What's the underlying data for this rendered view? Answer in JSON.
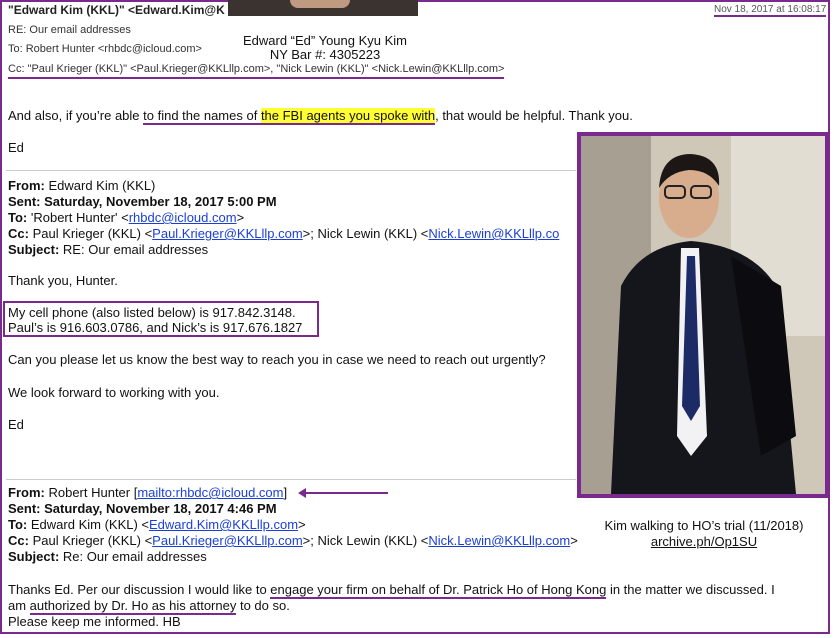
{
  "header": {
    "from": "\"Edward Kim (KKL)\" <Edward.Kim@K",
    "date": "Nov 18, 2017 at 16:08:17",
    "subject": "RE: Our email addresses",
    "to": "To: Robert Hunter <rhbdc@icloud.com>",
    "cc": "Cc: \"Paul Krieger (KKL)\" <Paul.Krieger@KKLllp.com>, \"Nick Lewin (KKL)\" <Nick.Lewin@KKLllp.com>"
  },
  "attorney": {
    "name": "Edward “Ed” Young Kyu Kim",
    "bar": "NY Bar #: 4305223"
  },
  "reply": {
    "line1_pre": "And also, if you’re able ",
    "line1_ul_a": "to find the names of ",
    "line1_hl": "the FBI agents you spoke with",
    "line1_post": ", that would be helpful.  Thank you.",
    "sign": "Ed"
  },
  "msg1": {
    "from_label": "From:",
    "from": "Edward Kim (KKL)",
    "sent_label": "Sent:",
    "sent": "Saturday, November 18, 2017 5:00 PM",
    "to_label": "To:",
    "to_pre": "'Robert Hunter' <",
    "to_link": "rhbdc@icloud.com",
    "to_post": ">",
    "cc_label": "Cc:",
    "cc_pre": "Paul Krieger (KKL) <",
    "cc_link1": "Paul.Krieger@KKLllp.com",
    "cc_mid": ">; Nick Lewin (KKL) <",
    "cc_link2": "Nick.Lewin@KKLllp.co",
    "subject_label": "Subject:",
    "subject": "RE: Our email addresses",
    "greeting": "Thank you, Hunter.",
    "phone1": "My cell phone (also listed below) is 917.842.3148.",
    "phone2": "Paul’s is 916.603.0786, and Nick’s is 917.676.1827",
    "ask": "Can you please let us know the best way to reach you in case we need to reach out urgently?",
    "look": "We look forward to working with you.",
    "sign": "Ed"
  },
  "msg2": {
    "from_label": "From:",
    "from_pre": "Robert Hunter [",
    "from_link": "mailto:rhbdc@icloud.com",
    "from_post": "]",
    "sent_label": "Sent:",
    "sent": "Saturday, November 18, 2017 4:46 PM",
    "to_label": "To:",
    "to_pre": "Edward Kim (KKL) <",
    "to_link": "Edward.Kim@KKLllp.com",
    "to_post": ">",
    "cc_label": "Cc:",
    "cc_pre": "Paul Krieger (KKL) <",
    "cc_link1": "Paul.Krieger@KKLllp.com",
    "cc_mid": ">; Nick Lewin (KKL) <",
    "cc_link2": "Nick.Lewin@KKLllp.com",
    "cc_post": ">",
    "subject_label": "Subject:",
    "subject": "Re: Our email addresses",
    "body1_pre": "Thanks Ed. Per our discussion I would like to ",
    "body1_ul": "engage your firm on behalf of Dr. Patrick Ho of Hong Kong",
    "body1_post": " in the matter we discussed. I",
    "body2_pre": "am ",
    "body2_ul": "authorized by Dr. Ho as his attorney",
    "body2_post": " to do so.",
    "body3": "Please keep me informed. HB"
  },
  "caption": {
    "line1": "Kim walking to HO’s trial (11/2018)",
    "link": "archive.ph/Op1SU"
  },
  "colors": {
    "accent": "#7a2a8c",
    "highlight": "#ffff33",
    "link": "#1a3fd8"
  }
}
